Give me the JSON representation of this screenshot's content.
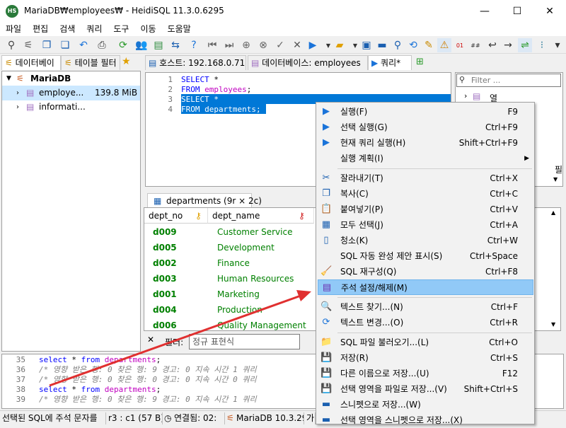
{
  "window": {
    "title": "MariaDB₩employees₩ - HeidiSQL 11.3.0.6295",
    "icon_text": "HS",
    "minimize": "—",
    "maximize": "☐",
    "close": "✕"
  },
  "menubar": [
    "파일",
    "편집",
    "검색",
    "쿼리",
    "도구",
    "이동",
    "도움말"
  ],
  "tabs": {
    "left": [
      "데이터베이",
      "테이블 필터"
    ],
    "host": "호스트: 192.168.0.71",
    "database": "데이터베이스: employees",
    "query": "쿼리*"
  },
  "tree": {
    "root": "MariaDB",
    "items": [
      {
        "label": "employe...",
        "size": "139.8 MiB"
      },
      {
        "label": "informati...",
        "size": ""
      }
    ]
  },
  "editor": {
    "line_numbers": [
      "1",
      "2",
      "3",
      "4"
    ],
    "lines": [
      {
        "kw": "SELECT",
        "rest": " *"
      },
      {
        "kw": "FROM",
        "tbl": "employees",
        "end": ";"
      },
      {
        "kw": "SELECT",
        "rest": " *"
      },
      {
        "kw": "FROM",
        "tbl": "departments",
        "end": ";"
      }
    ]
  },
  "filter_panel": {
    "placeholder": "Filter ...",
    "tree_item": "열",
    "partial_text": "필"
  },
  "results": {
    "tab_label": "departments (9r × 2c)",
    "columns": [
      "dept_no",
      "dept_name"
    ],
    "rows": [
      [
        "d009",
        "Customer Service"
      ],
      [
        "d005",
        "Development"
      ],
      [
        "d002",
        "Finance"
      ],
      [
        "d003",
        "Human Resources"
      ],
      [
        "d001",
        "Marketing"
      ],
      [
        "d004",
        "Production"
      ],
      [
        "d006",
        "Quality Management"
      ]
    ],
    "filter_label": "필터:",
    "filter_placeholder": "정규 표현식",
    "close_x": "✕"
  },
  "log": {
    "lines": [
      {
        "num": "35",
        "type": "sql",
        "a": "select",
        "b": " * ",
        "c": "from",
        "d": " departments",
        "e": ";"
      },
      {
        "num": "36",
        "type": "comment",
        "text": "/* 영향 받은 행: 0  찾은 행: 9  경고: 0  지속 시간 1 쿼리"
      },
      {
        "num": "37",
        "type": "comment",
        "text": "/* 영향 받은 행: 0  찾은 행: 0  경고: 0  지속 시간 0 쿼리"
      },
      {
        "num": "38",
        "type": "sql",
        "a": "select",
        "b": " * ",
        "c": "from",
        "d": " departments",
        "e": ";"
      },
      {
        "num": "39",
        "type": "comment",
        "text": "/* 영향 받은 행: 0  찾은 행: 9  경고: 0  지속 시간 1 쿼리"
      }
    ]
  },
  "statusbar": {
    "hint": "선택된 SQL에 주석 문자를",
    "position": "r3 : c1 (57 B)",
    "connected": "연결됨: 02:",
    "server": "MariaDB 10.3.29",
    "extra": "가"
  },
  "context_menu": {
    "items": [
      {
        "icon": "run-icon",
        "glyph": "▶",
        "color": "#1a73d9",
        "label": "실행(F)",
        "shortcut": "F9"
      },
      {
        "icon": "run-selection-icon",
        "glyph": "▶",
        "color": "#1a73d9",
        "label": "선택 실행(G)",
        "shortcut": "Ctrl+F9"
      },
      {
        "icon": "run-current-query-icon",
        "glyph": "▶",
        "color": "#1a73d9",
        "label": "현재 쿼리 실행(H)",
        "shortcut": "Shift+Ctrl+F9"
      },
      {
        "icon": "",
        "glyph": "",
        "color": "#000000",
        "label": "실행 계획(I)",
        "shortcut": "",
        "submenu": true
      },
      {
        "sep": true
      },
      {
        "icon": "cut-icon",
        "glyph": "✂",
        "color": "#1a5fb0",
        "label": "잘라내기(T)",
        "shortcut": "Ctrl+X"
      },
      {
        "icon": "copy-icon",
        "glyph": "❐",
        "color": "#1a5fb0",
        "label": "복사(C)",
        "shortcut": "Ctrl+C"
      },
      {
        "icon": "paste-icon",
        "glyph": "📋",
        "color": "#1a5fb0",
        "label": "붙여넣기(P)",
        "shortcut": "Ctrl+V"
      },
      {
        "icon": "select-all-icon",
        "glyph": "▦",
        "color": "#1a5fb0",
        "label": "모두 선택(J)",
        "shortcut": "Ctrl+A"
      },
      {
        "icon": "clear-icon",
        "glyph": "▯",
        "color": "#1a5fb0",
        "label": "청소(K)",
        "shortcut": "Ctrl+W"
      },
      {
        "icon": "",
        "glyph": "",
        "color": "#000000",
        "label": "SQL 자동 완성 제안 표시(S)",
        "shortcut": "Ctrl+Space"
      },
      {
        "icon": "reformat-icon",
        "glyph": "🧹",
        "color": "#c88a00",
        "label": "SQL 재구성(Q)",
        "shortcut": "Ctrl+F8"
      },
      {
        "icon": "comment-icon",
        "glyph": "▤",
        "color": "#6a2fb0",
        "label": "주석 설정/해제(M)",
        "shortcut": "",
        "highlight": true
      },
      {
        "sep": true
      },
      {
        "icon": "find-icon",
        "glyph": "🔍",
        "color": "#1a5fb0",
        "label": "텍스트 찾기...(N)",
        "shortcut": "Ctrl+F"
      },
      {
        "icon": "replace-icon",
        "glyph": "⟳",
        "color": "#1a73d9",
        "label": "텍스트 변경...(O)",
        "shortcut": "Ctrl+R"
      },
      {
        "sep": true
      },
      {
        "icon": "open-file-icon",
        "glyph": "📁",
        "color": "#e0a000",
        "label": "SQL 파일 불러오기...(L)",
        "shortcut": "Ctrl+O"
      },
      {
        "icon": "save-icon",
        "glyph": "💾",
        "color": "#1a5fb0",
        "label": "저장(R)",
        "shortcut": "Ctrl+S"
      },
      {
        "icon": "save-as-icon",
        "glyph": "💾",
        "color": "#1a5fb0",
        "label": "다른 이름으로 저장...(U)",
        "shortcut": "F12"
      },
      {
        "icon": "save-selection-icon",
        "glyph": "💾",
        "color": "#1a5fb0",
        "label": "선택 영역을 파일로 저장...(V)",
        "shortcut": "Shift+Ctrl+S"
      },
      {
        "icon": "snippet-icon",
        "glyph": "▬",
        "color": "#1a5fb0",
        "label": "스니펫으로 저장...(W)",
        "shortcut": ""
      },
      {
        "icon": "snippet-selection-icon",
        "glyph": "▬",
        "color": "#1a5fb0",
        "label": "선택 영역을 스니펫으로 저장...(X)",
        "shortcut": ""
      }
    ]
  },
  "colors": {
    "accent": "#0078d7",
    "keyword": "#0000ff",
    "table": "#c000c0",
    "result_text": "#008000",
    "highlight": "#91c9f7",
    "annotation_arrow": "#e03030"
  }
}
